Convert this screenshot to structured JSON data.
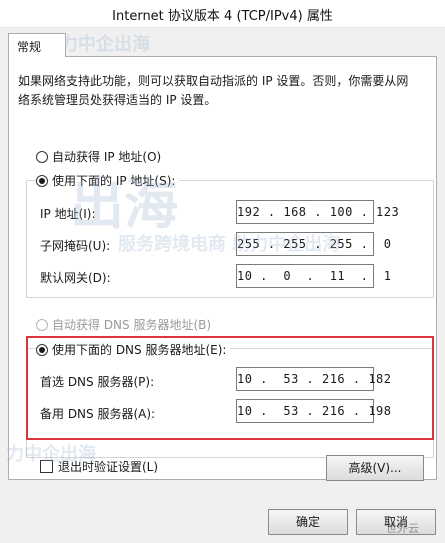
{
  "window": {
    "title": "Internet 协议版本 4 (TCP/IPv4) 属性"
  },
  "tabs": [
    {
      "label": "常规"
    }
  ],
  "description": "如果网络支持此功能，则可以获取自动指派的 IP 设置。否则，你需要从网络系统管理员处获得适当的 IP 设置。",
  "ip_section": {
    "auto_label": "自动获得 IP 地址(O)",
    "manual_label": "使用下面的 IP 地址(S):",
    "selected": "manual",
    "fields": [
      {
        "label": "IP 地址(I):",
        "value": "192 . 168 . 100 . 123"
      },
      {
        "label": "子网掩码(U):",
        "value": "255 . 255 . 255 .  0"
      },
      {
        "label": "默认网关(D):",
        "value": "10 .  0  .  11  .  1"
      }
    ]
  },
  "dns_section": {
    "auto_label": "自动获得 DNS 服务器地址(B)",
    "manual_label": "使用下面的 DNS 服务器地址(E):",
    "selected": "manual",
    "fields": [
      {
        "label": "首选 DNS 服务器(P):",
        "value": "10 .  53 . 216 . 182"
      },
      {
        "label": "备用 DNS 服务器(A):",
        "value": "10 .  53 . 216 . 198"
      }
    ]
  },
  "validate_checkbox": {
    "label": "退出时验证设置(L)",
    "checked": false
  },
  "buttons": {
    "advanced": "高级(V)...",
    "ok": "确定",
    "cancel": "取消"
  },
  "watermarks": {
    "brand": "出海",
    "slogan": "服务跨境电商 助力中企出海",
    "slogan_top": "助力中企出海",
    "slogan_bottom": "力中企出海",
    "corner": "世外云"
  },
  "colors": {
    "highlight_border": "#d9363e",
    "watermark": "#96afcd"
  }
}
